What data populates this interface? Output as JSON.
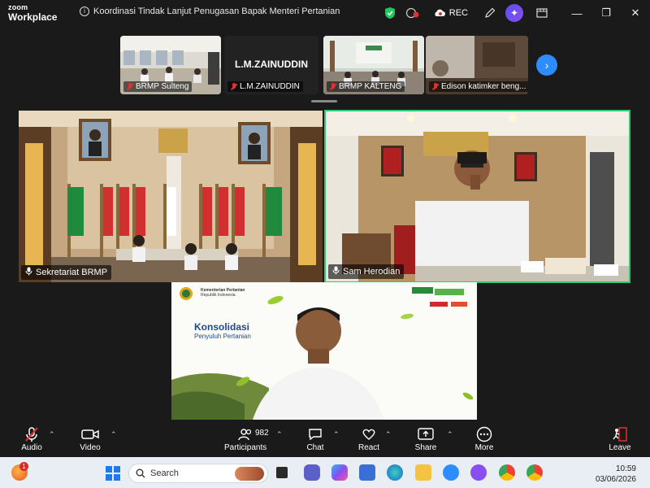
{
  "app": {
    "brand_line1": "zoom",
    "brand_line2": "Workplace"
  },
  "meeting": {
    "title": "Koordinasi Tindak Lanjut Penugasan Bapak Menteri Pertanian",
    "rec_label": "REC"
  },
  "strip": {
    "tiles": [
      {
        "label": "BRMP Sulteng"
      },
      {
        "label": "L.M.ZAINUDDIN"
      },
      {
        "label": "BRMP KALTENG"
      },
      {
        "label": "Edison katimker beng..."
      }
    ],
    "name_tile": "L.M.ZAINUDDIN"
  },
  "gallery": {
    "tiles": [
      {
        "label": "Sekretariat BRMP"
      },
      {
        "label": "Sam Herodian"
      }
    ],
    "share": {
      "logo_line1": "Kementerian Pertanian",
      "logo_line2": "Republik Indonesia",
      "title": "Konsolidasi",
      "subtitle": "Penyuluh Pertanian"
    }
  },
  "toolbar": {
    "audio": "Audio",
    "video": "Video",
    "participants": "Participants",
    "participants_count": "982",
    "chat": "Chat",
    "react": "React",
    "share": "Share",
    "more": "More",
    "leave": "Leave"
  },
  "taskbar": {
    "search_placeholder": "Search",
    "notification_count": "1",
    "time": "10:59",
    "date": "03/06/2026"
  },
  "colors": {
    "accent": "#2d8cff",
    "active_speaker": "#2ecc71",
    "muted": "#e03030",
    "leave": "#e03030"
  }
}
